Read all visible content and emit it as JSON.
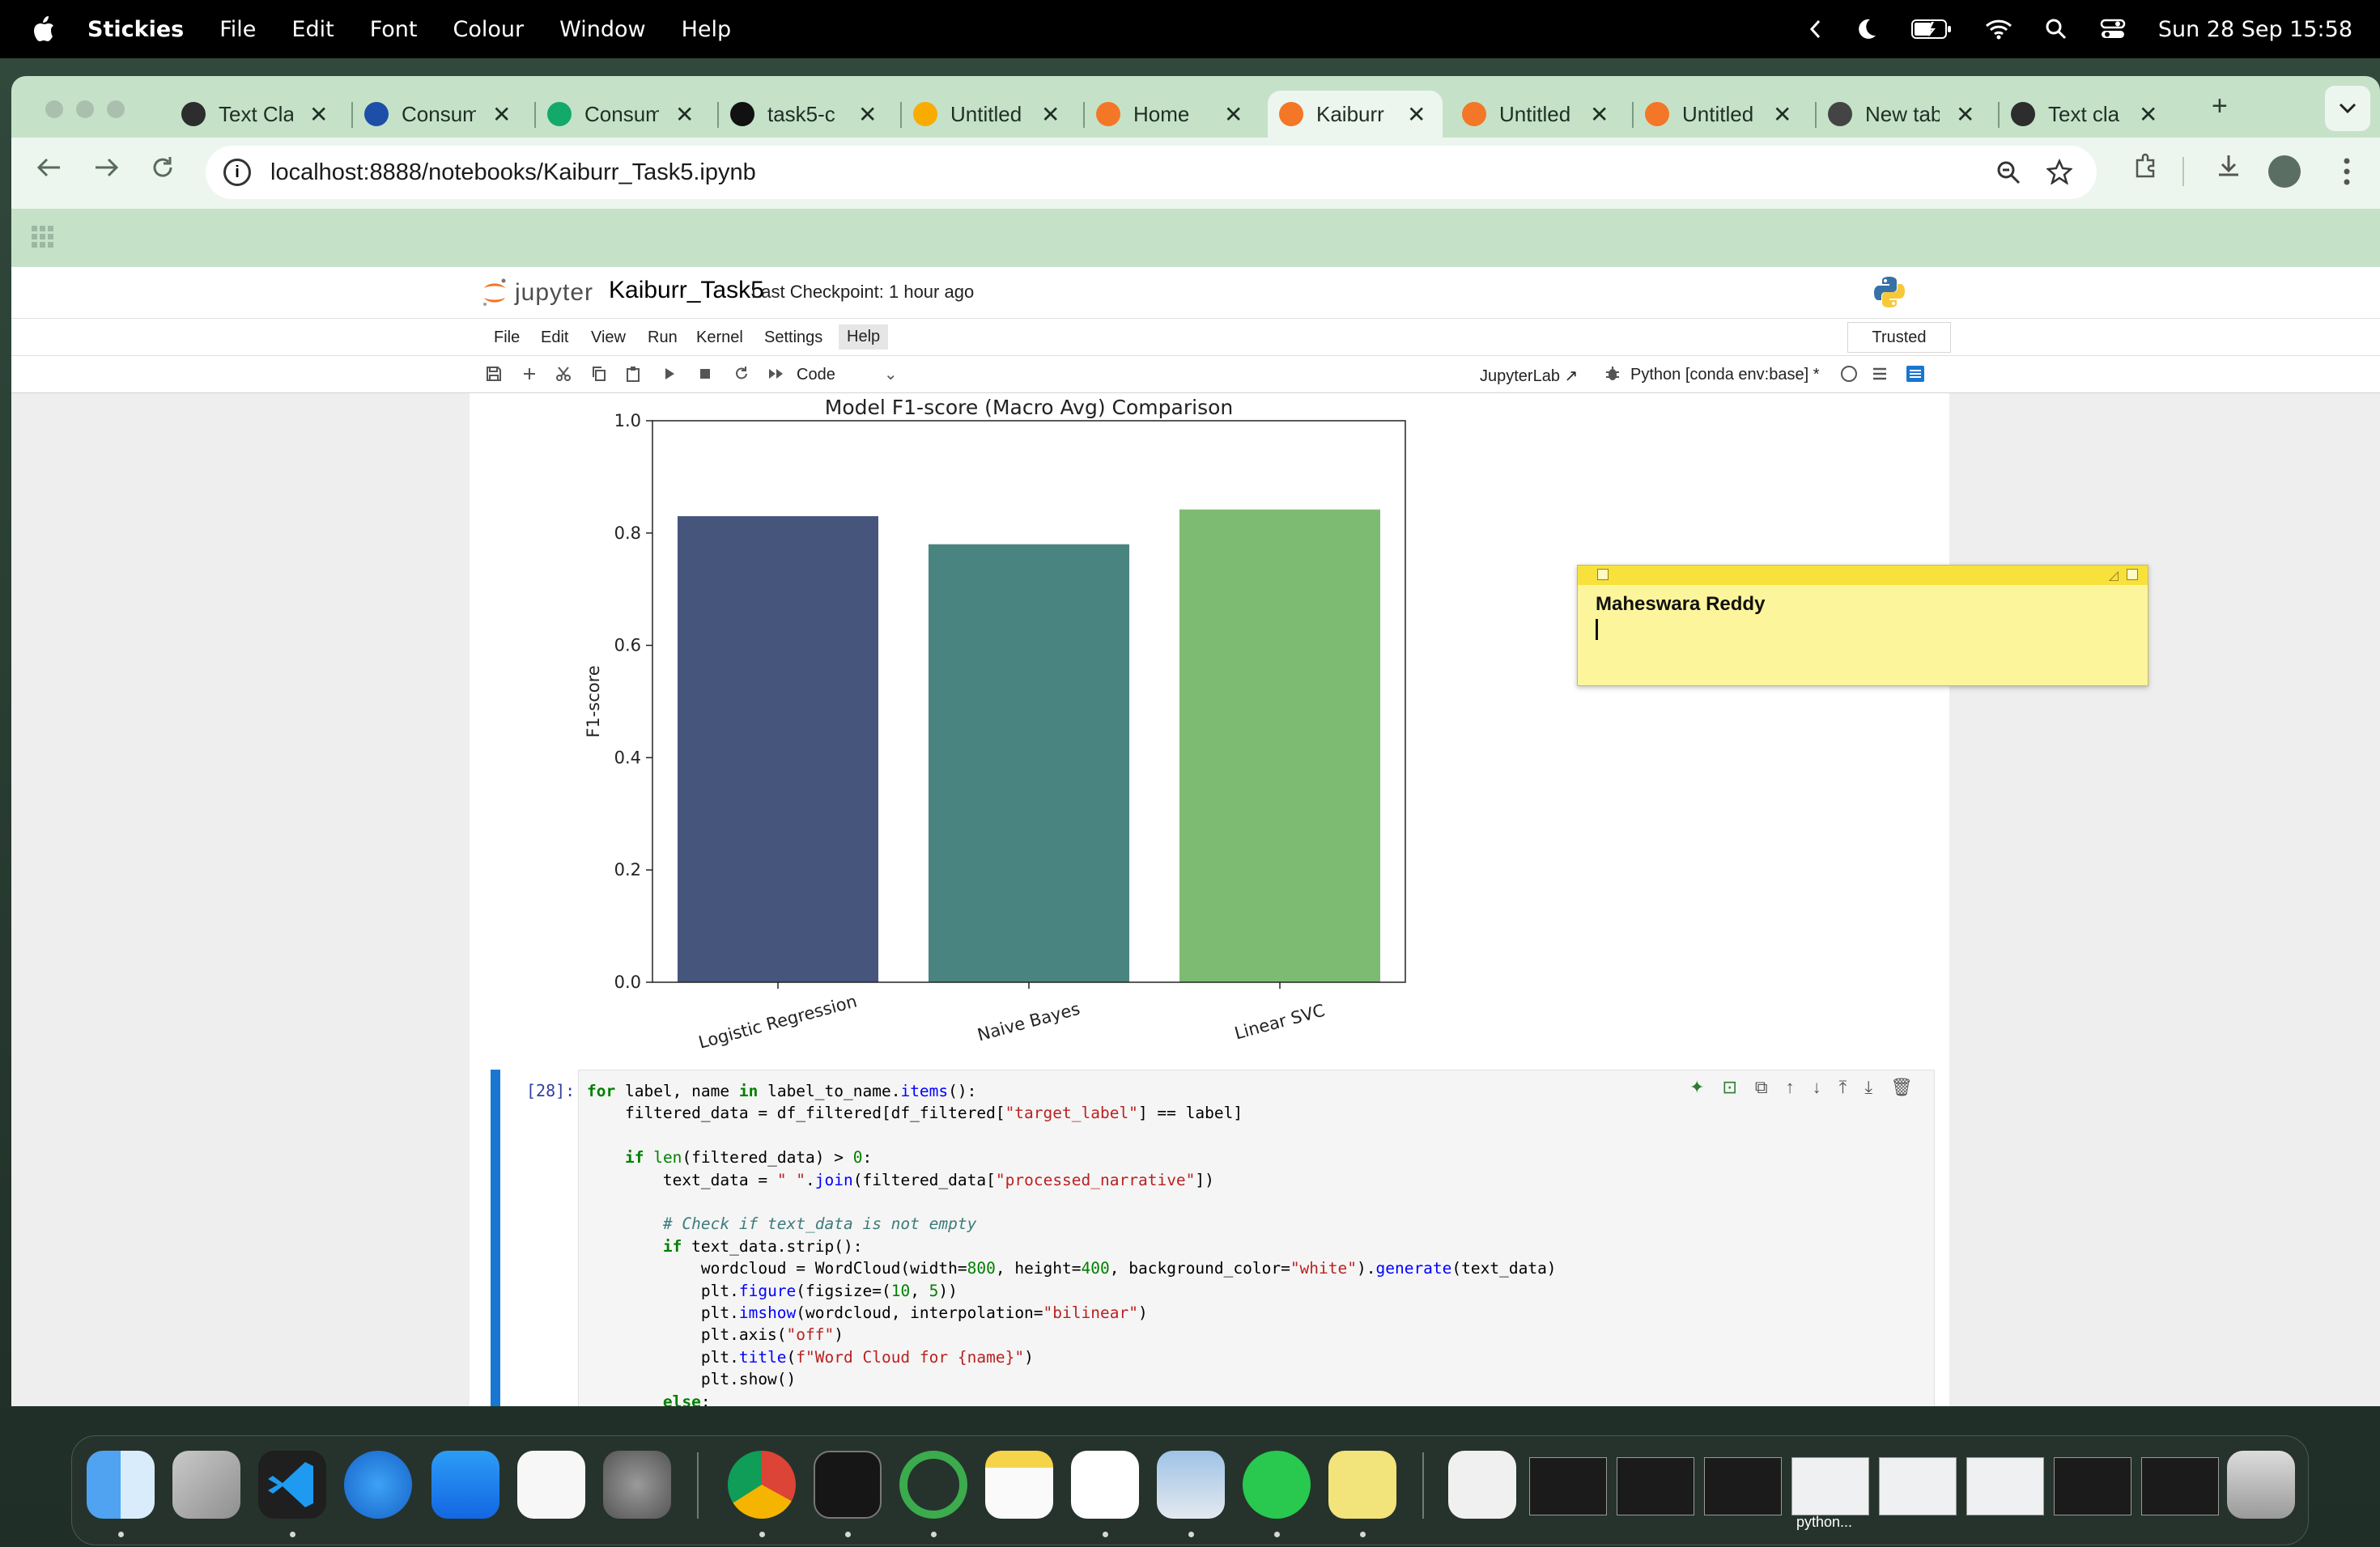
{
  "menubar": {
    "app_name": "Stickies",
    "items": [
      "File",
      "Edit",
      "Font",
      "Colour",
      "Window",
      "Help"
    ],
    "clock": "Sun 28 Sep  15:58"
  },
  "browser": {
    "tabs": [
      {
        "label": "Text Cla",
        "icon": "chatgpt-icon",
        "color": "#2d2d2d"
      },
      {
        "label": "Consum",
        "icon": "d-logo-icon",
        "color": "#1e4fa8"
      },
      {
        "label": "Consum",
        "icon": "c-logo-icon",
        "color": "#13a96a"
      },
      {
        "label": "task5-c",
        "icon": "github-icon",
        "color": "#111111"
      },
      {
        "label": "Untitled",
        "icon": "colab-icon",
        "color": "#f9ab00"
      },
      {
        "label": "Home",
        "icon": "jupyter-icon",
        "color": "#f37726"
      },
      {
        "label": "Kaiburr",
        "icon": "notebook-icon",
        "color": "#f37726"
      },
      {
        "label": "Untitled",
        "icon": "notebook-icon",
        "color": "#f37726"
      },
      {
        "label": "Untitled",
        "icon": "notebook-icon",
        "color": "#f37726"
      },
      {
        "label": "New tab",
        "icon": "chrome-icon",
        "color": "#444444"
      },
      {
        "label": "Text cla",
        "icon": "chatgpt-icon",
        "color": "#2d2d2d"
      }
    ],
    "active_tab": 6,
    "url_host": "localhost",
    "url_rest": ":8888/notebooks/Kaiburr_Task5.ipynb"
  },
  "jupyter": {
    "brand": "jupyter",
    "notebook_title": "Kaiburr_Task5",
    "checkpoint": "Last Checkpoint: 1 hour ago",
    "menu": [
      "File",
      "Edit",
      "View",
      "Run",
      "Kernel",
      "Settings",
      "Help"
    ],
    "trusted": "Trusted",
    "cell_type": "Code",
    "jupyterlab_link": "JupyterLab",
    "kernel": "Python [conda env:base] *",
    "cell_prompt": "[28]:",
    "code": [
      "for label, name in label_to_name.items():",
      "    filtered_data = df_filtered[df_filtered[\"target_label\"] == label]",
      "",
      "    if len(filtered_data) > 0:",
      "        text_data = \" \".join(filtered_data[\"processed_narrative\"])",
      "",
      "        # Check if text_data is not empty",
      "        if text_data.strip():",
      "            wordcloud = WordCloud(width=800, height=400, background_color=\"white\").generate(text_data)",
      "            plt.figure(figsize=(10, 5))",
      "            plt.imshow(wordcloud, interpolation=\"bilinear\")",
      "            plt.axis(\"off\")",
      "            plt.title(f\"Word Cloud for {name}\")",
      "            plt.show()",
      "        else:"
    ]
  },
  "chart_data": {
    "type": "bar",
    "title": "Model F1-score (Macro Avg) Comparison",
    "xlabel": "",
    "ylabel": "F1-score",
    "categories": [
      "Logistic Regression",
      "Naive Bayes",
      "Linear SVC"
    ],
    "values": [
      0.83,
      0.78,
      0.842
    ],
    "colors": [
      "#46557c",
      "#4a8480",
      "#7ebb72"
    ],
    "ylim": [
      0,
      1.0
    ],
    "yticks": [
      "0.0",
      "0.2",
      "0.4",
      "0.6",
      "0.8",
      "1.0"
    ],
    "grid": false
  },
  "sticky": {
    "text": "Maheswara Reddy",
    "color": "#fdf59c"
  },
  "dock": {
    "thumb_label": "python..."
  }
}
